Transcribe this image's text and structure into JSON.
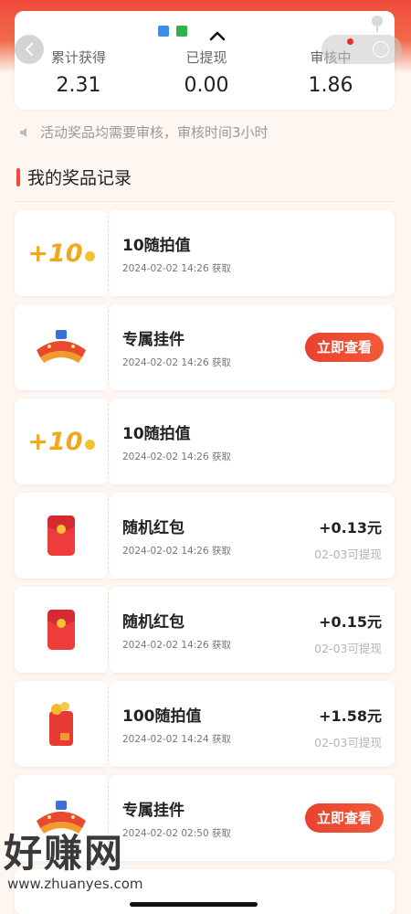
{
  "stats": [
    {
      "label": "累计获得",
      "value": "2.31"
    },
    {
      "label": "已提现",
      "value": "0.00"
    },
    {
      "label": "审核中",
      "value": "1.86"
    }
  ],
  "notice": "活动奖品均需要审核，审核时间3小时",
  "section_title": "我的奖品记录",
  "records": [
    {
      "name": "10随拍值",
      "time": "2024-02-02 14:26 获取",
      "thumb": "plus10",
      "badge": "+10"
    },
    {
      "name": "专属挂件",
      "time": "2024-02-02 14:26 获取",
      "thumb": "pendant",
      "button": "立即查看"
    },
    {
      "name": "10随拍值",
      "time": "2024-02-02 14:26 获取",
      "thumb": "plus10",
      "badge": "+10"
    },
    {
      "name": "随机红包",
      "time": "2024-02-02 14:26 获取",
      "thumb": "redpacket",
      "amount": "+0.13元",
      "withdraw": "02-03可提现"
    },
    {
      "name": "随机红包",
      "time": "2024-02-02 14:26 获取",
      "thumb": "redpacket",
      "amount": "+0.15元",
      "withdraw": "02-03可提现"
    },
    {
      "name": "100随拍值",
      "time": "2024-02-02 14:24 获取",
      "thumb": "coinpacket",
      "amount": "+1.58元",
      "withdraw": "02-03可提现"
    },
    {
      "name": "专属挂件",
      "time": "2024-02-02 02:50 获取",
      "thumb": "pendant",
      "button": "立即查看"
    }
  ],
  "watermark": {
    "big": "好赚网",
    "small": "www.zhuanyes.com"
  },
  "colors": {
    "accent": "#f04a3c",
    "button": "#e8422f",
    "background": "#fdf6f1"
  },
  "icons": [
    "back-arrow-icon",
    "caret-up-icon",
    "speaker-icon",
    "close-circle-icon",
    "more-dot-icon"
  ]
}
